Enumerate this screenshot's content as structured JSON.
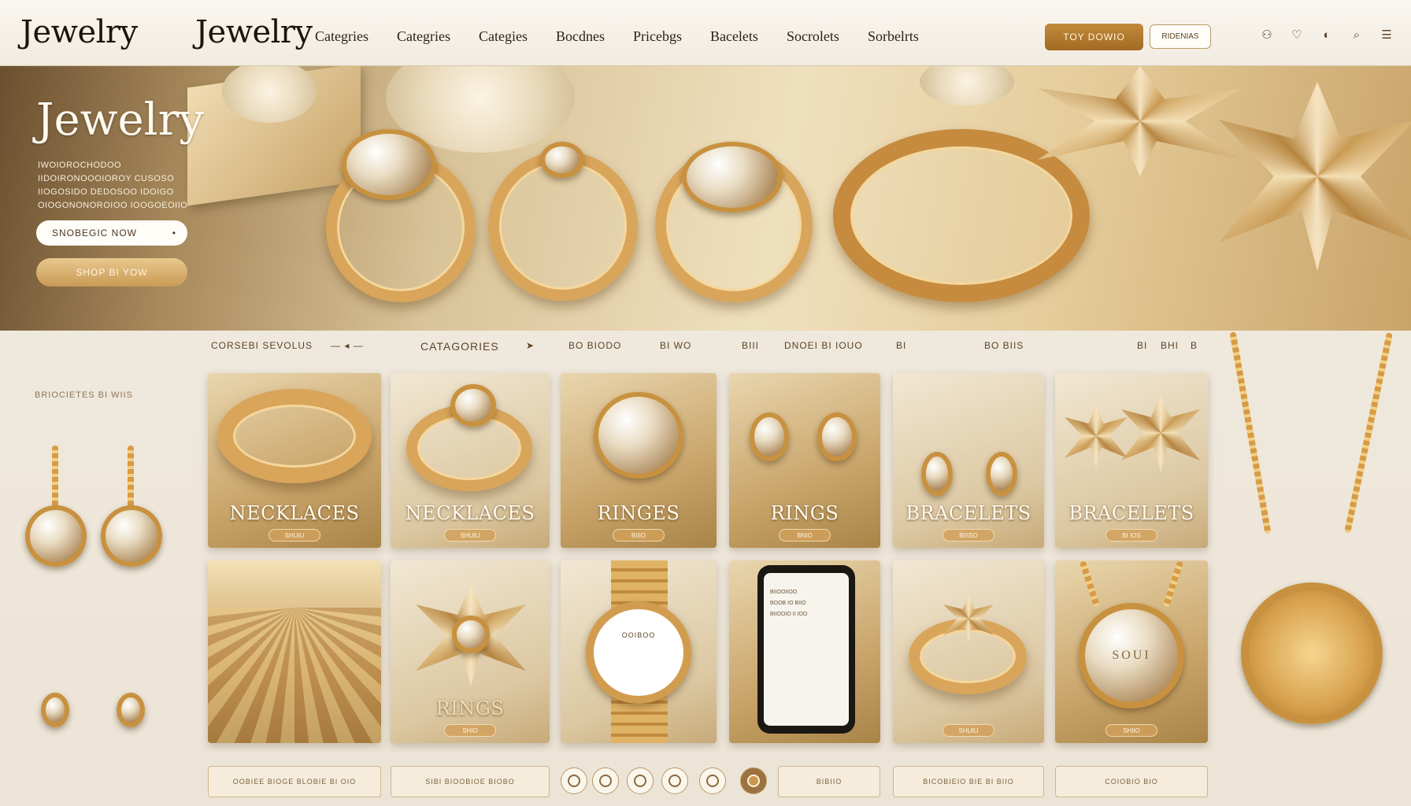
{
  "header": {
    "logo_primary": "Jewelry",
    "logo_secondary": "Jewelry",
    "nav": [
      "Categries",
      "Categries",
      "Categies",
      "Bocdnes",
      "Pricebgs",
      "Bacelets",
      "Socrolets",
      "Sorbelrts"
    ],
    "shop_button": "TOY DOWIO",
    "sign_button": "RIDENIAS",
    "icons": [
      "user-icon",
      "heart-icon",
      "bag-icon",
      "search-icon",
      "menu-icon"
    ]
  },
  "hero": {
    "title": "Jewelry",
    "subtitle": "IWOIOROCHODOO IIDOIRONOOOIOROY CUSOSO IIOGOSIDO DEDOSOO IDOIGO OIOGONONOROIOO IOOGOEOIIO",
    "button_primary": "SNOBEGIC NOW",
    "button_primary_arrow": "•",
    "button_secondary": "SHOP BI YOW"
  },
  "categories_bar": {
    "items": [
      "CORSEBI SEVOLUS",
      "CATAGORIES",
      "BO BIODO",
      "BI WO",
      "BIII",
      "DNOEI BI IOUO",
      "BI",
      "BO BIIS"
    ],
    "right_items": [
      "BI",
      "BHI",
      "B"
    ]
  },
  "side_label": "BRIOCIETES BI WIIS",
  "tiles_row1": [
    {
      "label": "NECKLACES",
      "tag": "SHUIU"
    },
    {
      "label": "NECKLACES",
      "tag": "SHUIU"
    },
    {
      "label": "RINGES",
      "tag": "BIIIO"
    },
    {
      "label": "RINGS",
      "tag": "BNIO"
    },
    {
      "label": "BRACELETS",
      "tag": "BIIISO"
    },
    {
      "label": "BRACELETS",
      "tag": "BI IOS"
    }
  ],
  "tiles_row2": [
    {
      "label": "",
      "tag": ""
    },
    {
      "label": "RINGS",
      "tag": "SHIO"
    },
    {
      "label": "",
      "tag": ""
    },
    {
      "label": "",
      "tag": ""
    },
    {
      "label": "",
      "tag": "SHUIU"
    },
    {
      "label": "",
      "tag": "SHIIO"
    }
  ],
  "tile_overlay_text": {
    "watch_brand": "OOIBOO",
    "phone_lines": [
      "BIIOOIIOO",
      "BOOB IO BIIO",
      "BIIOOIO II IOO"
    ],
    "pendant_text": "SOUI"
  },
  "bottom_bar": {
    "left_boxes": [
      "OOBIEE BIOGE BLOBIE BI OIO",
      "SIBI BIOOBIOE BIOBO"
    ],
    "pagination_count": 7,
    "right_boxes": [
      "BIBIIO",
      "BICOBIEIO BIE BI BIIO",
      "COIOBIO BIO"
    ]
  },
  "colors": {
    "accent_gold": "#c28a3c",
    "dark_text": "#1d150c",
    "bg": "#f1ebe1"
  }
}
